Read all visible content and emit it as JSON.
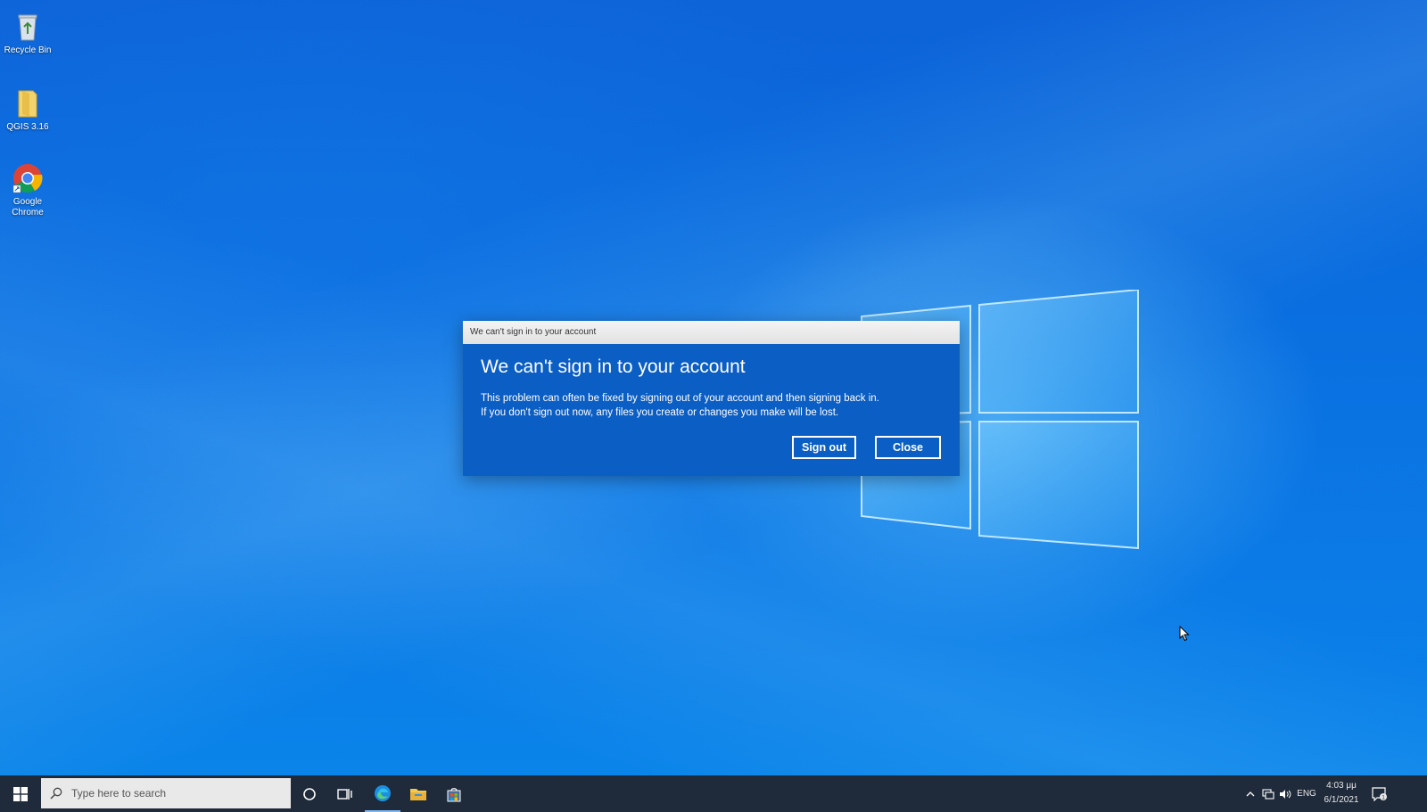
{
  "desktop": {
    "icons": [
      {
        "label": "Recycle Bin",
        "icon": "recycle-bin-icon"
      },
      {
        "label": "QGIS 3.16",
        "icon": "folder-icon"
      },
      {
        "label": "Google Chrome",
        "icon": "chrome-icon"
      }
    ]
  },
  "dialog": {
    "window_title": "We can't sign in to your account",
    "heading": "We can't sign in to your account",
    "line1": "This problem can often be fixed by signing out of your account and then signing back in.",
    "line2": "If you don't sign out now, any files you create or changes you make will be lost.",
    "sign_out_label": "Sign out",
    "close_label": "Close"
  },
  "taskbar": {
    "search_placeholder": "Type here to search",
    "items": [
      {
        "icon": "cortana-icon"
      },
      {
        "icon": "task-view-icon"
      },
      {
        "icon": "edge-icon"
      },
      {
        "icon": "file-explorer-icon"
      },
      {
        "icon": "store-icon"
      }
    ],
    "tray": {
      "language": "ENG",
      "time": "4:03 μμ",
      "date": "6/1/2021",
      "notification_count": "1"
    }
  },
  "colors": {
    "dialog_bg": "#0b5ec4",
    "taskbar_bg": "#1f2a3a",
    "desktop_blue": "#0a6fe0"
  }
}
